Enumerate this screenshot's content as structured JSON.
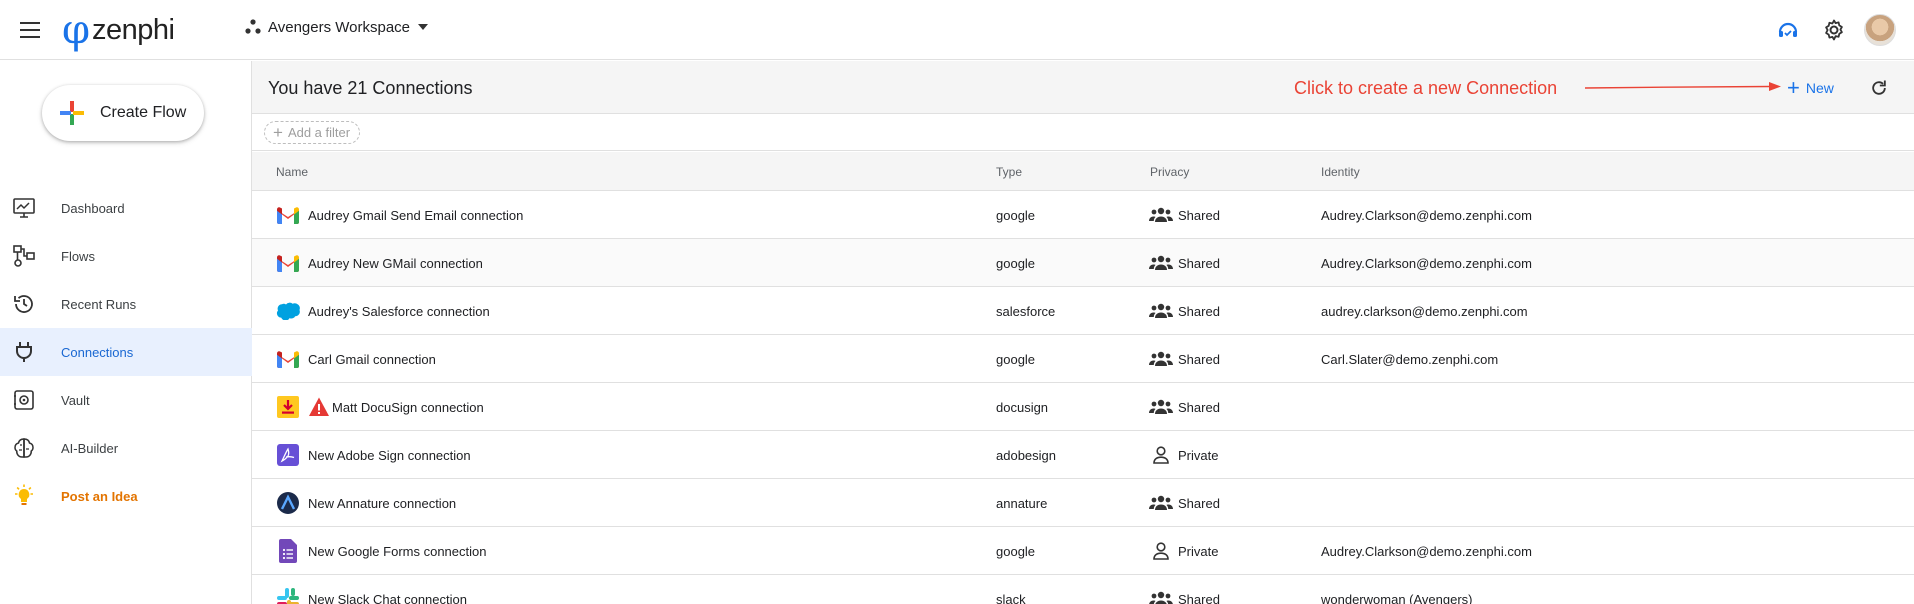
{
  "app": {
    "brand": "zenphi",
    "workspace": "Avengers Workspace"
  },
  "sidebar": {
    "create_flow": "Create Flow",
    "items": [
      {
        "label": "Dashboard",
        "icon": "monitor-icon"
      },
      {
        "label": "Flows",
        "icon": "flow-icon"
      },
      {
        "label": "Recent Runs",
        "icon": "history-icon"
      },
      {
        "label": "Connections",
        "icon": "plug-icon",
        "active": true
      },
      {
        "label": "Vault",
        "icon": "vault-icon"
      },
      {
        "label": "AI-Builder",
        "icon": "brain-icon"
      },
      {
        "label": "Post an Idea",
        "icon": "lightbulb-icon"
      }
    ]
  },
  "main": {
    "title": "You have 21 Connections",
    "hint": "Click to create a new Connection",
    "new_label": "New",
    "add_filter": "Add a filter",
    "columns": {
      "name": "Name",
      "type": "Type",
      "privacy": "Privacy",
      "identity": "Identity"
    },
    "rows": [
      {
        "name": "Audrey Gmail Send Email connection",
        "type": "google",
        "privacy": "Shared",
        "identity": "Audrey.Clarkson@demo.zenphi.com",
        "icon": "gmail-icon"
      },
      {
        "name": "Audrey New GMail connection",
        "type": "google",
        "privacy": "Shared",
        "identity": "Audrey.Clarkson@demo.zenphi.com",
        "icon": "gmail-icon"
      },
      {
        "name": "Audrey's Salesforce connection",
        "type": "salesforce",
        "privacy": "Shared",
        "identity": "audrey.clarkson@demo.zenphi.com",
        "icon": "salesforce-icon"
      },
      {
        "name": "Carl Gmail connection",
        "type": "google",
        "privacy": "Shared",
        "identity": "Carl.Slater@demo.zenphi.com",
        "icon": "gmail-icon"
      },
      {
        "name": "Matt DocuSign connection",
        "type": "docusign",
        "privacy": "Shared",
        "identity": "",
        "icon": "docusign-icon",
        "warning": true
      },
      {
        "name": "New Adobe Sign connection",
        "type": "adobesign",
        "privacy": "Private",
        "identity": "",
        "icon": "adobesign-icon"
      },
      {
        "name": "New Annature connection",
        "type": "annature",
        "privacy": "Shared",
        "identity": "",
        "icon": "annature-icon"
      },
      {
        "name": "New Google Forms connection",
        "type": "google",
        "privacy": "Private",
        "identity": "Audrey.Clarkson@demo.zenphi.com",
        "icon": "google-forms-icon"
      },
      {
        "name": "New Slack Chat connection",
        "type": "slack",
        "privacy": "Shared",
        "identity": "wonderwoman (Avengers)",
        "icon": "slack-icon"
      }
    ]
  },
  "colors": {
    "accent": "#1a73e8",
    "hint": "#ea4335",
    "idea": "#e37400",
    "active_bg": "#e8f0fe"
  }
}
